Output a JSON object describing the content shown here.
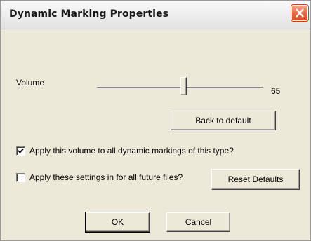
{
  "window": {
    "title": "Dynamic Marking Properties",
    "close_icon": "close-icon"
  },
  "volume": {
    "label": "Volume",
    "value_text": "65",
    "slider_fraction": 0.52
  },
  "buttons": {
    "back_to_default": "Back to default",
    "reset_defaults": "Reset Defaults",
    "ok": "OK",
    "cancel": "Cancel"
  },
  "options": {
    "apply_all_dynamic": {
      "label": "Apply this volume to all dynamic markings of this type?",
      "checked": true
    },
    "apply_future_files": {
      "label": "Apply these settings in for all future files?",
      "checked": false
    }
  },
  "colors": {
    "dialog_bg": "#ece9d8",
    "close_button": "#e4673f"
  }
}
